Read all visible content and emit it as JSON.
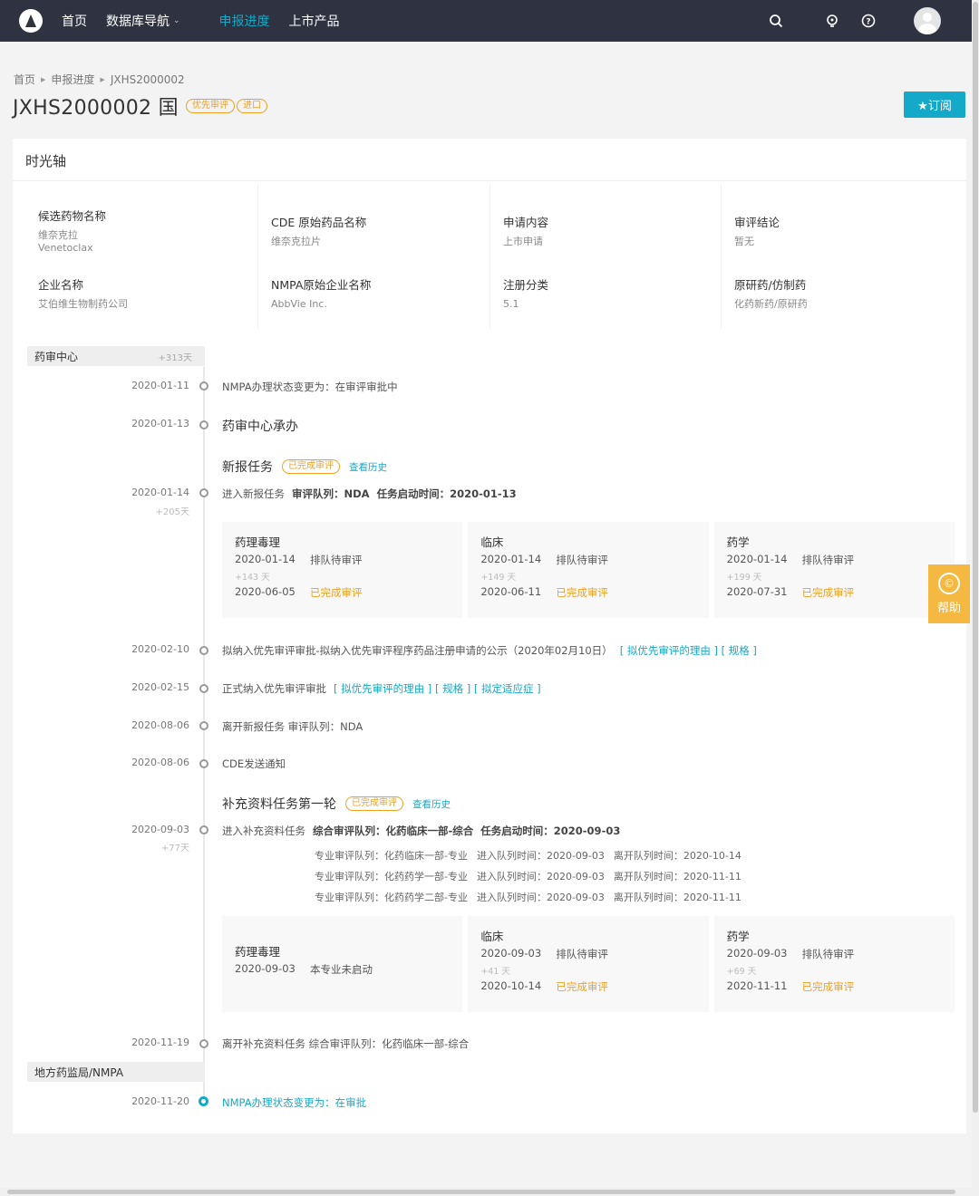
{
  "nav": {
    "items": [
      "首页",
      "数据库导航",
      "申报进度",
      "上市产品"
    ],
    "active_index": 2,
    "icons": [
      "search-icon",
      "lightbulb-icon",
      "help-icon",
      "avatar"
    ]
  },
  "breadcrumb": [
    "首页",
    "申报进度",
    "JXHS2000002"
  ],
  "title": "JXHS2000002 国",
  "tags": [
    "优先审评",
    "进口"
  ],
  "subscribe_label": "★订阅",
  "panel_title": "时光轴",
  "info": [
    {
      "label": "候选药物名称",
      "value": "维奈克拉",
      "value2": "Venetoclax"
    },
    {
      "label": "CDE 原始药品名称",
      "value": "维奈克拉片"
    },
    {
      "label": "申请内容",
      "value": "上市申请"
    },
    {
      "label": "审评结论",
      "value": "暂无"
    },
    {
      "label": "企业名称",
      "value": "艾伯维生物制药公司"
    },
    {
      "label": "NMPA原始企业名称",
      "value": "AbbVie Inc."
    },
    {
      "label": "注册分类",
      "value": "5.1"
    },
    {
      "label": "原研药/仿制药",
      "value": "化药新药/原研药"
    }
  ],
  "sections": {
    "cde": {
      "name": "药审中心",
      "days": "+313天"
    },
    "nmpa": {
      "name": "地方药监局/NMPA"
    }
  },
  "events": {
    "e1": {
      "date": "2020-01-11",
      "text": "NMPA办理状态变更为：在审评审批中"
    },
    "e2": {
      "date": "2020-01-13",
      "text": "药审中心承办"
    },
    "task1": {
      "title": "新报任务",
      "status": "已完成审评",
      "history": "查看历史"
    },
    "e3": {
      "date": "2020-01-14",
      "days": "+205天",
      "text": "进入新报任务",
      "queue": "审评队列：NDA",
      "start": "任务启动时间：2020-01-13"
    },
    "e4": {
      "date": "2020-02-10",
      "text": "拟纳入优先审评审批-拟纳入优先审评程序药品注册申请的公示（2020年02月10日）",
      "links": "[ 拟优先审评的理由 ] [ 规格 ]"
    },
    "e5": {
      "date": "2020-02-15",
      "text": "正式纳入优先审评审批",
      "links": "[ 拟优先审评的理由 ] [ 规格 ] [ 拟定适应症 ]"
    },
    "e6": {
      "date": "2020-08-06",
      "text": "离开新报任务   审评队列：NDA"
    },
    "e7": {
      "date": "2020-08-06",
      "text": "CDE发送通知"
    },
    "task2": {
      "title": "补充资料任务第一轮",
      "status": "已完成审评",
      "history": "查看历史"
    },
    "e8": {
      "date": "2020-09-03",
      "days": "+77天",
      "text": "进入补充资料任务",
      "queue": "综合审评队列：化药临床一部-综合",
      "start": "任务启动时间：2020-09-03"
    },
    "e9": {
      "date": "2020-11-19",
      "text": "离开补充资料任务   综合审评队列：化药临床一部-综合"
    },
    "e10": {
      "date": "2020-11-20",
      "text": "NMPA办理状态变更为：在审批"
    }
  },
  "cards1": [
    {
      "title": "药理毒理",
      "date1": "2020-01-14",
      "status1": "排队待审评",
      "days": "+143 天",
      "date2": "2020-06-05",
      "status2": "已完成审评"
    },
    {
      "title": "临床",
      "date1": "2020-01-14",
      "status1": "排队待审评",
      "days": "+149 天",
      "date2": "2020-06-11",
      "status2": "已完成审评"
    },
    {
      "title": "药学",
      "date1": "2020-01-14",
      "status1": "排队待审评",
      "days": "+199 天",
      "date2": "2020-07-31",
      "status2": "已完成审评"
    }
  ],
  "queues": [
    {
      "queue": "专业审评队列：化药临床一部-专业",
      "enter": "进入队列时间：2020-09-03",
      "leave": "离开队列时间：2020-10-14"
    },
    {
      "queue": "专业审评队列：化药药学一部-专业",
      "enter": "进入队列时间：2020-09-03",
      "leave": "离开队列时间：2020-11-11"
    },
    {
      "queue": "专业审评队列：化药药学二部-专业",
      "enter": "进入队列时间：2020-09-03",
      "leave": "离开队列时间：2020-11-11"
    }
  ],
  "cards2": [
    {
      "title": "药理毒理",
      "date1": "2020-09-03",
      "status1": "本专业未启动"
    },
    {
      "title": "临床",
      "date1": "2020-09-03",
      "status1": "排队待审评",
      "days": "+41 天",
      "date2": "2020-10-14",
      "status2": "已完成审评"
    },
    {
      "title": "药学",
      "date1": "2020-09-03",
      "status1": "排队待审评",
      "days": "+69 天",
      "date2": "2020-11-11",
      "status2": "已完成审评"
    }
  ],
  "help_label": "帮助",
  "colors": {
    "accent": "#14a9c9",
    "nav_bg": "#2f3240",
    "done": "#f0a020"
  }
}
